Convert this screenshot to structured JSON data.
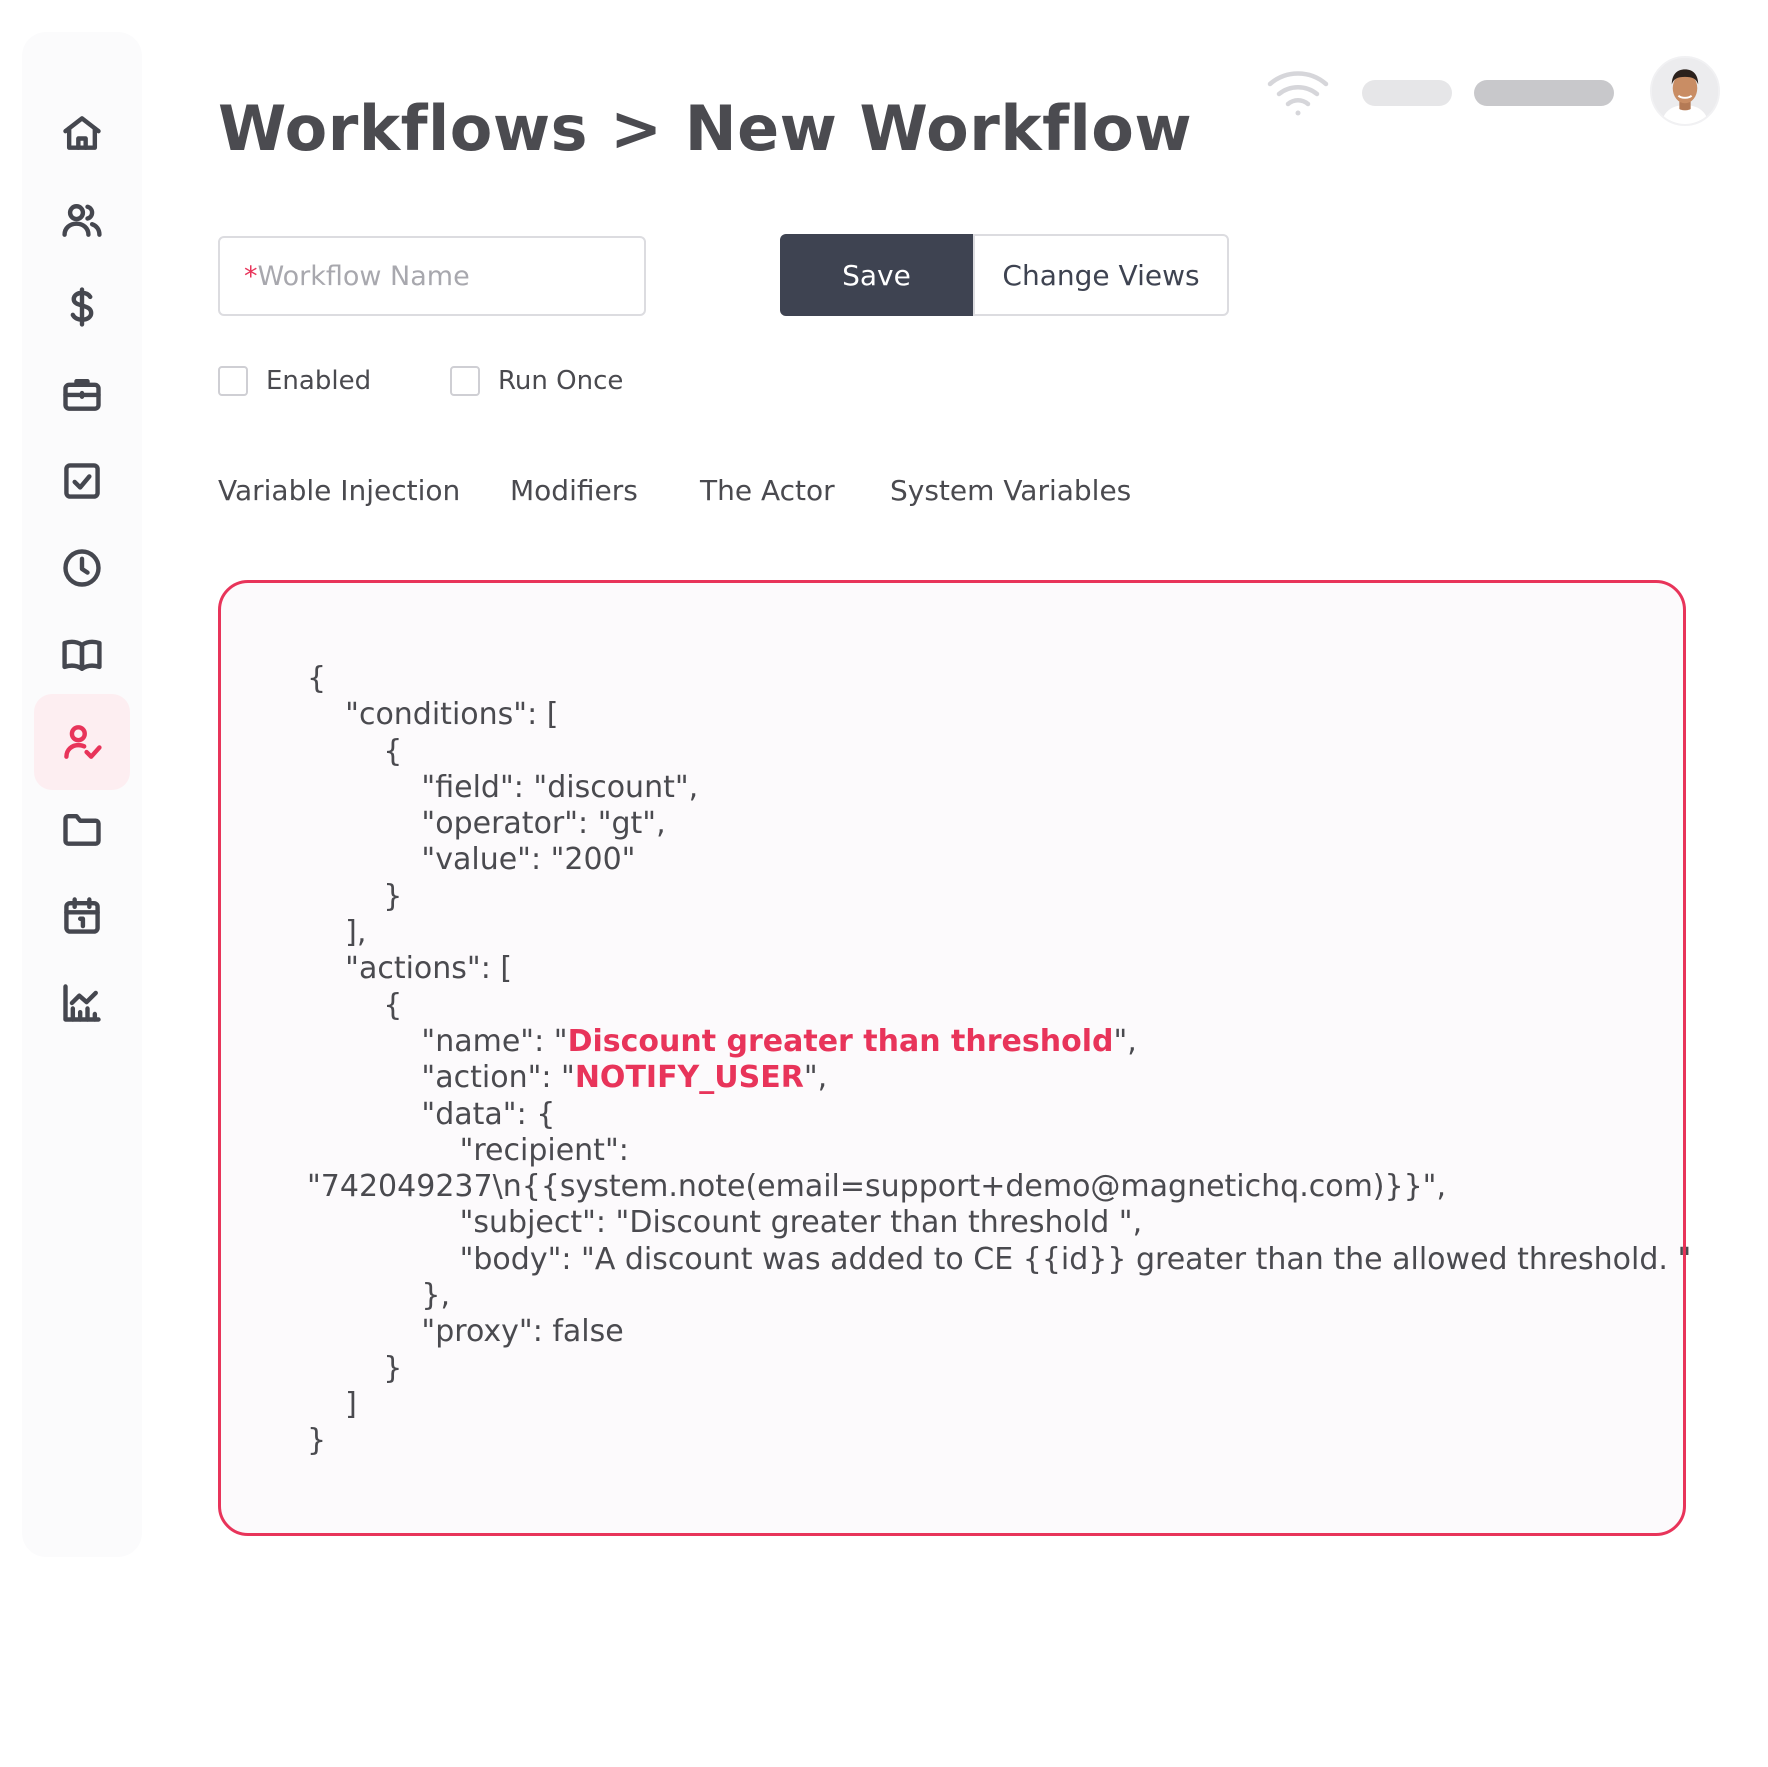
{
  "page": {
    "title": "Workflows > New Workflow"
  },
  "sidebar": {
    "items": [
      {
        "icon": "home-icon",
        "name": "sidebar-item-home"
      },
      {
        "icon": "users-icon",
        "name": "sidebar-item-users"
      },
      {
        "icon": "dollar-icon",
        "name": "sidebar-item-billing"
      },
      {
        "icon": "briefcase-icon",
        "name": "sidebar-item-jobs"
      },
      {
        "icon": "checkbox-icon",
        "name": "sidebar-item-tasks"
      },
      {
        "icon": "clock-icon",
        "name": "sidebar-item-history"
      },
      {
        "icon": "book-icon",
        "name": "sidebar-item-docs"
      },
      {
        "icon": "user-check-icon",
        "name": "sidebar-item-workflows",
        "active": true
      },
      {
        "icon": "folder-icon",
        "name": "sidebar-item-files"
      },
      {
        "icon": "calendar-icon",
        "name": "sidebar-item-calendar"
      },
      {
        "icon": "chart-icon",
        "name": "sidebar-item-reports"
      }
    ]
  },
  "form": {
    "required_marker": "*",
    "name_placeholder": "Workflow Name",
    "save_label": "Save",
    "change_views_label": "Change Views",
    "enabled_label": "Enabled",
    "enabled_checked": false,
    "run_once_label": "Run Once",
    "run_once_checked": false
  },
  "tabs": [
    "Variable Injection",
    "Modifiers",
    "The Actor",
    "System Variables"
  ],
  "code": {
    "l01": "{",
    "l02": "    \"conditions\": [",
    "l03": "        {",
    "l04": "            \"field\": \"discount\",",
    "l05": "            \"operator\": \"gt\",",
    "l06": "            \"value\": \"200\"",
    "l07": "        }",
    "l08": "    ],",
    "l09": "    \"actions\": [",
    "l10": "        {",
    "l11_pre": "            \"name\": \"",
    "l11_hl": "Discount greater than threshold",
    "l11_post": "\",",
    "l12_pre": "            \"action\": \"",
    "l12_hl": "NOTIFY_USER",
    "l12_post": "\",",
    "l13": "            \"data\": {",
    "l14": "                \"recipient\":",
    "l15": "\"742049237\\n{{system.note(email=support+demo@magnetichq.com)}}\",",
    "l16": "                \"subject\": \"Discount greater than threshold \",",
    "l17": "                \"body\": \"A discount was added to CE {{id}} greater than the allowed threshold. \"",
    "l18": "            },",
    "l19": "            \"proxy\": false",
    "l20": "        }",
    "l21": "    ]",
    "l22": "}"
  },
  "colors": {
    "accent": "#e8345a",
    "primary_button": "#3e4351",
    "text": "#4a4a4f"
  }
}
